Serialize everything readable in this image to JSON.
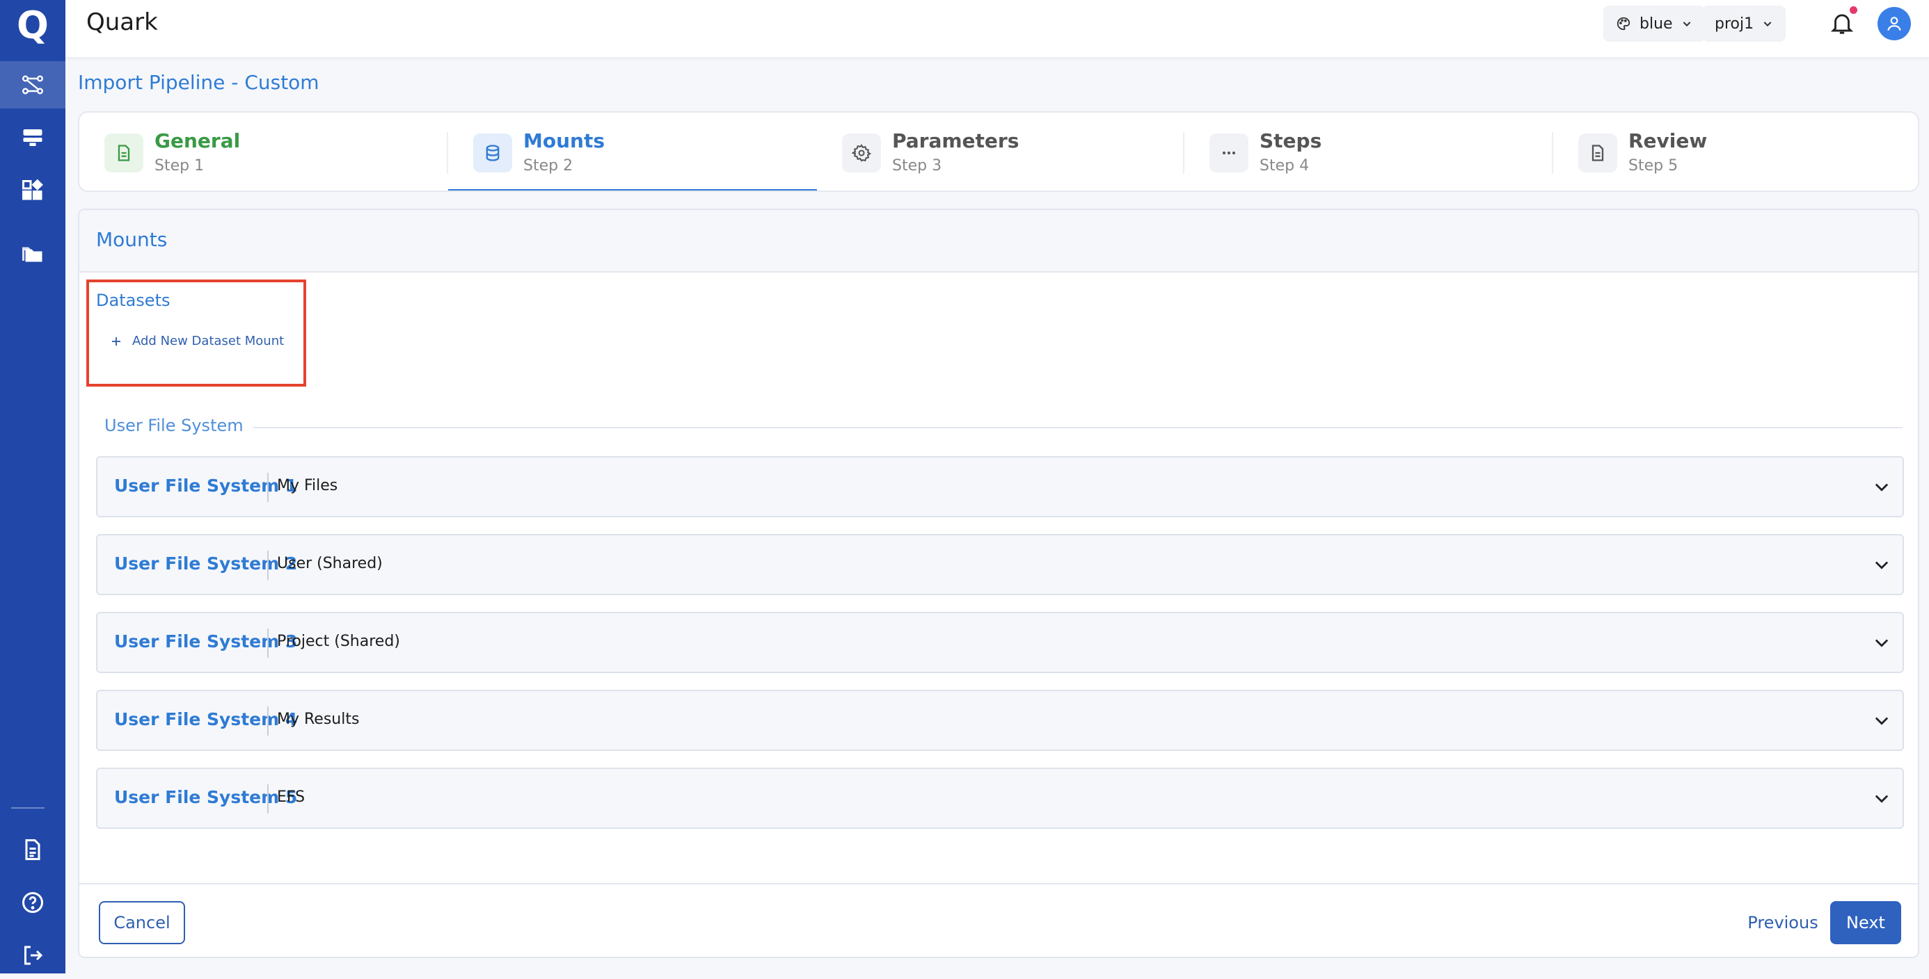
{
  "app": {
    "title": "Quark",
    "logo_letter": "Q"
  },
  "topbar": {
    "theme_label": "blue",
    "project_label": "proj1"
  },
  "page": {
    "title": "Import Pipeline - Custom"
  },
  "steps": [
    {
      "title": "General",
      "subtitle": "Step 1",
      "icon": "document-icon",
      "state": "done"
    },
    {
      "title": "Mounts",
      "subtitle": "Step 2",
      "icon": "database-icon",
      "state": "active"
    },
    {
      "title": "Parameters",
      "subtitle": "Step 3",
      "icon": "gear-icon",
      "state": "pending"
    },
    {
      "title": "Steps",
      "subtitle": "Step 4",
      "icon": "ellipsis-icon",
      "state": "pending"
    },
    {
      "title": "Review",
      "subtitle": "Step 5",
      "icon": "document-icon",
      "state": "pending"
    }
  ],
  "mounts": {
    "title": "Mounts",
    "datasets_label": "Datasets",
    "add_dataset_label": "Add New Dataset Mount",
    "fs_section_label": "User File System",
    "file_systems": [
      {
        "name": "User File System 1",
        "value": "My Files"
      },
      {
        "name": "User File System 2",
        "value": "User (Shared)"
      },
      {
        "name": "User File System 3",
        "value": "Project (Shared)"
      },
      {
        "name": "User File System 4",
        "value": "My Results"
      },
      {
        "name": "User File System 5",
        "value": "EFS"
      }
    ]
  },
  "footer": {
    "cancel_label": "Cancel",
    "previous_label": "Previous",
    "next_label": "Next"
  },
  "colors": {
    "sidebar": "#2148a8",
    "accent": "#2f7bd4",
    "done": "#3a9a45",
    "highlight": "#e5432e"
  }
}
